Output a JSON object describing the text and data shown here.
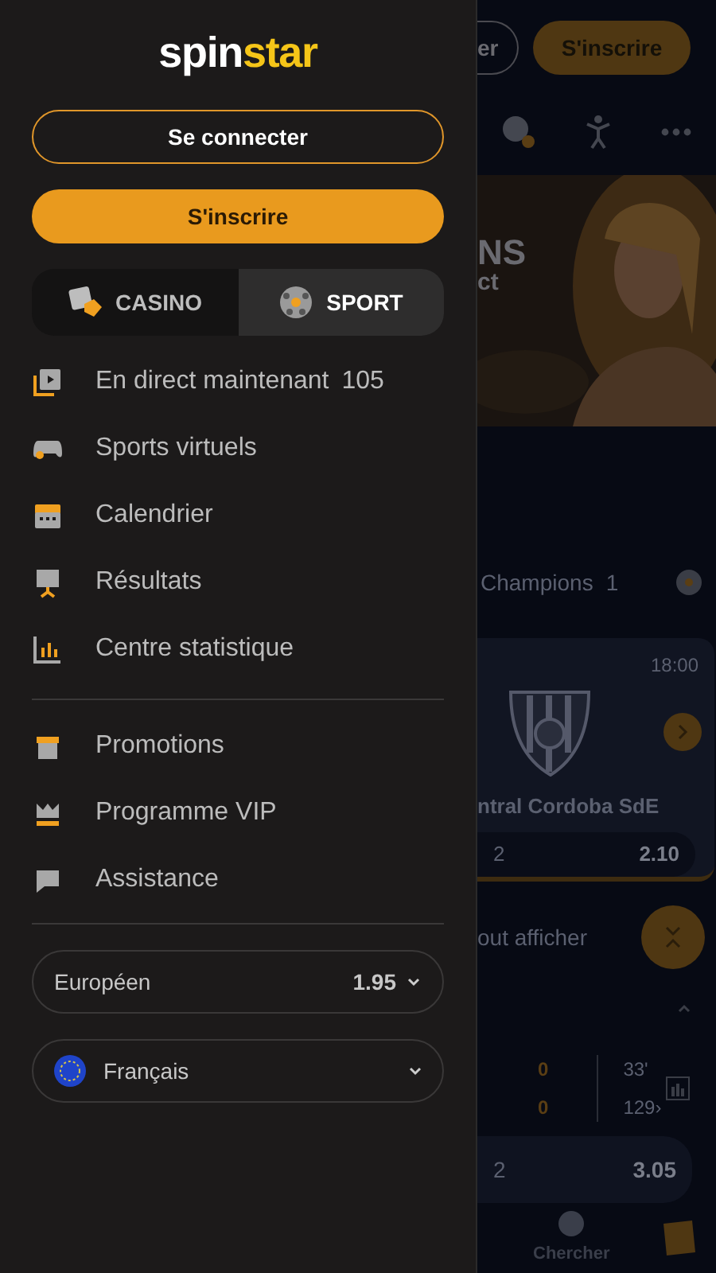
{
  "drawer": {
    "logo": {
      "first": "spin",
      "second": "star"
    },
    "login_button": "Se connecter",
    "signup_button": "S'inscrire",
    "tabs": [
      {
        "label": "CASINO",
        "kind": "casino",
        "selected": false
      },
      {
        "label": "SPORT",
        "kind": "sport",
        "selected": true
      }
    ],
    "menu_groups": [
      [
        {
          "label": "En direct maintenant",
          "count": "105",
          "kind": "live"
        },
        {
          "label": "Sports virtuels",
          "kind": "gamepad"
        },
        {
          "label": "Calendrier",
          "kind": "calendar"
        },
        {
          "label": "Résultats",
          "kind": "results"
        },
        {
          "label": "Centre statistique",
          "kind": "stats"
        }
      ],
      [
        {
          "label": "Promotions",
          "kind": "gift"
        },
        {
          "label": "Programme VIP",
          "kind": "crown"
        },
        {
          "label": "Assistance",
          "kind": "chat"
        }
      ]
    ],
    "odds_format": {
      "label": "Européen",
      "value": "1.95"
    },
    "language": {
      "label": "Français"
    }
  },
  "background": {
    "header_buttons": [
      "er",
      "S'inscrire"
    ],
    "banner_texts": [
      "NS",
      "ct"
    ],
    "league": {
      "name": "Champions",
      "count": "1"
    },
    "match": {
      "time": "18:00",
      "team": "ntral Cordoba SdE",
      "odd_label": "2",
      "odd_value": "2.10"
    },
    "show_all": "out afficher",
    "live_match": {
      "score_1": "0",
      "score_2": "0",
      "minute": "33'",
      "markets": "129›",
      "odd_label": "2",
      "odd_value": "3.05"
    },
    "bottom_nav": {
      "label": "Chercher"
    }
  }
}
